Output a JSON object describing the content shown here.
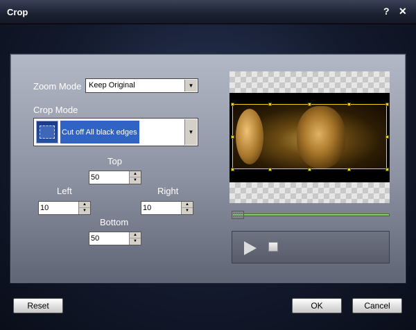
{
  "window": {
    "title": "Crop",
    "help_label": "?",
    "close_label": "✕"
  },
  "zoom": {
    "label": "Zoom Mode",
    "value": "Keep Original"
  },
  "crop": {
    "label": "Crop Mode",
    "value": "Cut off All black edges"
  },
  "margins": {
    "top_label": "Top",
    "top_value": "50",
    "left_label": "Left",
    "left_value": "10",
    "right_label": "Right",
    "right_value": "10",
    "bottom_label": "Bottom",
    "bottom_value": "50"
  },
  "buttons": {
    "reset": "Reset",
    "ok": "OK",
    "cancel": "Cancel"
  },
  "icons": {
    "dropdown": "chevron-down-icon",
    "spin_up": "arrow-up-icon",
    "spin_down": "arrow-down-icon",
    "play": "play-icon",
    "stop": "stop-icon"
  },
  "colors": {
    "accent": "#3163c5",
    "crop_frame": "#f3d21a",
    "slider": "#5caa46"
  }
}
